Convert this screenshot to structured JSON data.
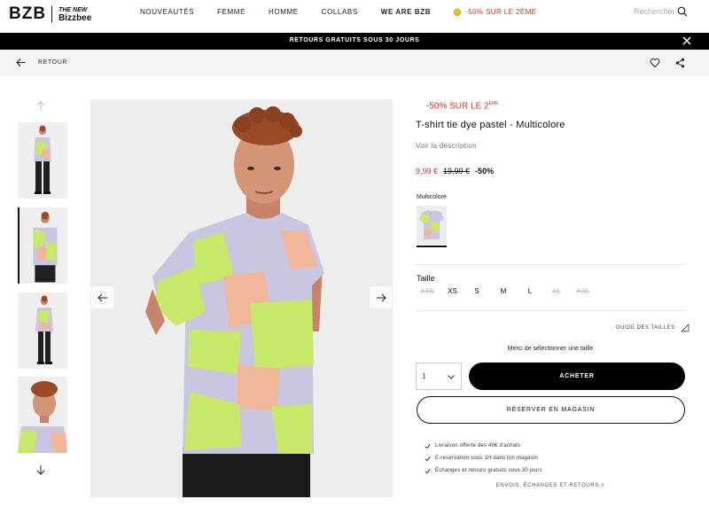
{
  "header": {
    "logo_main": "BZB",
    "logo_sub_line1": "THE NEW",
    "logo_sub_line2": "Bizzbee",
    "nav": [
      "NOUVEAUTÉS",
      "FEMME",
      "HOMME",
      "COLLABS",
      "WE ARE BZB"
    ],
    "promo": "-50% SUR LE 2ÈME",
    "search_placeholder": "Rechercher"
  },
  "banner": {
    "text": "RETOURS GRATUITS SOUS 30 JOURS"
  },
  "subbar": {
    "back_label": "RETOUR"
  },
  "product": {
    "promo_tag": "-50% SUR LE 2",
    "promo_tag_sup": "ÈME",
    "title": "T-shirt tie dye pastel - Multicolore",
    "description_link": "Voir la description",
    "price_now": "9,99 €",
    "price_old": "19,99 €",
    "discount": "-50%",
    "color_label": "Multicolore",
    "size_label": "Taille",
    "sizes": [
      {
        "label": "XXS",
        "available": false
      },
      {
        "label": "XS",
        "available": true
      },
      {
        "label": "S",
        "available": true
      },
      {
        "label": "M",
        "available": true
      },
      {
        "label": "L",
        "available": true
      },
      {
        "label": "XL",
        "available": false
      },
      {
        "label": "XXL",
        "available": false
      }
    ],
    "size_guide": "GUIDE DES TAILLES",
    "select_message": "Merci de sélectionner une taille",
    "quantity": "1",
    "buy_label": "ACHETER",
    "reserve_label": "RÉSERVER EN MAGASIN",
    "benefits": [
      "Livraison offerte dès 49€ d'achats",
      "E-reservation sous 1H dans ton magasin",
      "Échanges et retours gratuits sous 30 jours"
    ],
    "shipping_link": "ENVOIS, ÉCHANGES ET RETOURS >"
  },
  "colors": {
    "accent_red": "#c0392b",
    "shirt_lilac": "#c9c6e2",
    "shirt_lime": "#c8e86a",
    "shirt_peach": "#f0b79a"
  }
}
